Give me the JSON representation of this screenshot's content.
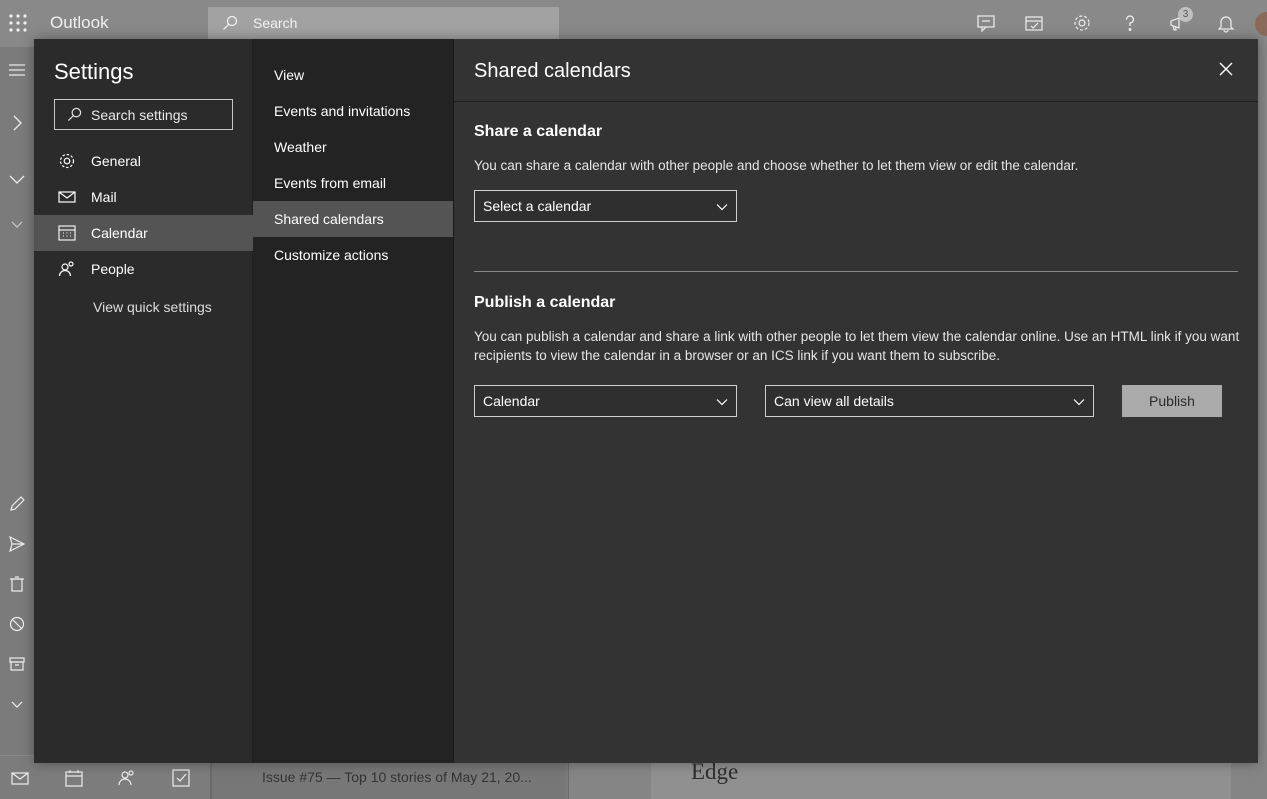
{
  "app": {
    "title": "Outlook"
  },
  "topbar": {
    "search_placeholder": "Search",
    "notification_count": "3"
  },
  "background": {
    "list_item_text": "Issue #75 — Top 10 stories of May 21, 20...",
    "reading_title": "Edge"
  },
  "settings": {
    "title": "Settings",
    "search_placeholder": "Search settings",
    "nav": [
      {
        "label": "General",
        "icon": "gear-icon"
      },
      {
        "label": "Mail",
        "icon": "mail-icon"
      },
      {
        "label": "Calendar",
        "icon": "calendar-icon",
        "active": true
      },
      {
        "label": "People",
        "icon": "people-icon"
      }
    ],
    "view_quick_settings": "View quick settings",
    "subnav": [
      {
        "label": "View"
      },
      {
        "label": "Events and invitations"
      },
      {
        "label": "Weather"
      },
      {
        "label": "Events from email"
      },
      {
        "label": "Shared calendars",
        "active": true
      },
      {
        "label": "Customize actions"
      }
    ]
  },
  "content": {
    "title": "Shared calendars",
    "share": {
      "heading": "Share a calendar",
      "description": "You can share a calendar with other people and choose whether to let them view or edit the calendar.",
      "select_value": "Select a calendar"
    },
    "publish": {
      "heading": "Publish a calendar",
      "description": "You can publish a calendar and share a link with other people to let them view the calendar online. Use an HTML link if you want recipients to view the calendar in a browser or an ICS link if you want them to subscribe.",
      "calendar_value": "Calendar",
      "permission_value": "Can view all details",
      "button_label": "Publish"
    }
  },
  "colors": {
    "dialog_bg": "#333333",
    "nav_bg": "#2b2b2b",
    "subnav_bg": "#232323",
    "active_item": "#545454",
    "publish_button": "#aaaaaa"
  }
}
